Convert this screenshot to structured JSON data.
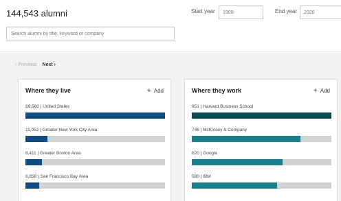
{
  "header": {
    "alumni_count": "144,543 alumni"
  },
  "filters": {
    "start_year_label": "Start year",
    "start_year_value": "1900",
    "end_year_label": "End year",
    "end_year_value": "2020"
  },
  "search": {
    "placeholder": "Search alumni by title, keyword or company"
  },
  "pager": {
    "previous_label": "Previous",
    "next_label": "Next"
  },
  "colors": {
    "live_bar": "#0f4c81",
    "work_bar_primary": "#0b4a57",
    "work_bar_secondary": "#1a7e8c",
    "bar_track": "#cfd1d3"
  },
  "cards": [
    {
      "title": "Where they live",
      "add_label": "Add",
      "rows": [
        {
          "label": "69,560  |  United States",
          "fraction": 1.0
        },
        {
          "label": "11,052  |  Greater New York City Area",
          "fraction": 0.16
        },
        {
          "label": "8,411  |  Greater Boston Area",
          "fraction": 0.12
        },
        {
          "label": "6,858  |  San Francisco Bay Area",
          "fraction": 0.1
        }
      ]
    },
    {
      "title": "Where they work",
      "add_label": "Add",
      "rows": [
        {
          "label": "951  |  Harvard Business School",
          "fraction": 1.0
        },
        {
          "label": "746  |  McKinsey & Company",
          "fraction": 0.78
        },
        {
          "label": "620  |  Google",
          "fraction": 0.65
        },
        {
          "label": "580  |  IBM",
          "fraction": 0.61
        }
      ]
    }
  ]
}
